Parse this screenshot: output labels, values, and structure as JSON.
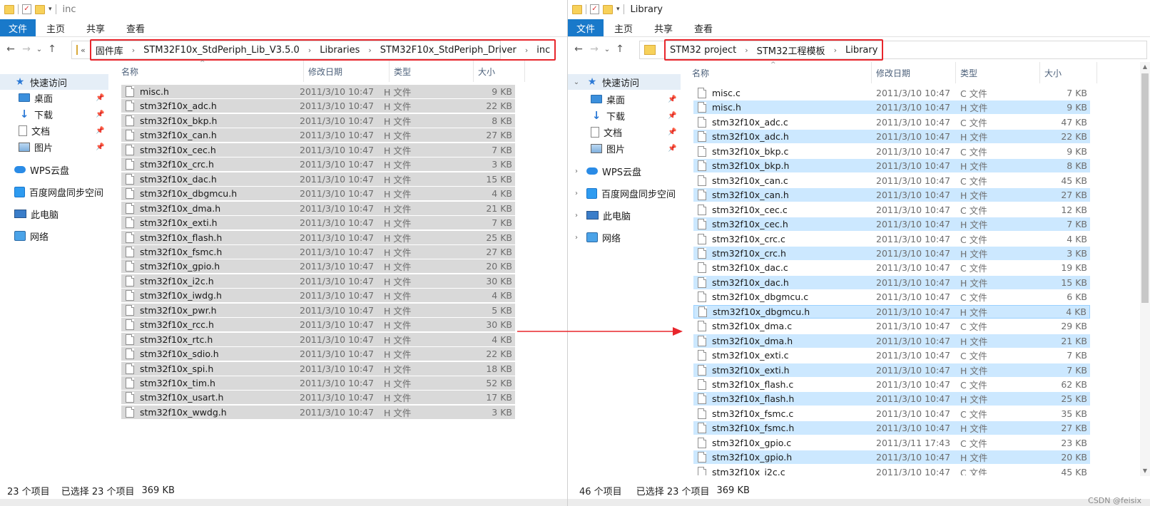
{
  "left": {
    "title": "inc",
    "ribbon": [
      "文件",
      "主页",
      "共享",
      "查看"
    ],
    "addr_prefix": "«",
    "breadcrumbs": [
      "固件库",
      "STM32F10x_StdPeriph_Lib_V3.5.0",
      "Libraries",
      "STM32F10x_StdPeriph_Driver",
      "inc"
    ],
    "columns": [
      "名称",
      "修改日期",
      "类型",
      "大小"
    ],
    "nav": [
      {
        "label": "快速访问",
        "icon": "star-icon",
        "selected": true
      },
      {
        "label": "桌面",
        "icon": "desktop-icon",
        "pinned": true
      },
      {
        "label": "下载",
        "icon": "download-icon",
        "pinned": true
      },
      {
        "label": "文档",
        "icon": "document-icon",
        "pinned": true
      },
      {
        "label": "图片",
        "icon": "pictures-icon",
        "pinned": true
      },
      {
        "label": "WPS云盘",
        "icon": "cloud-icon"
      },
      {
        "label": "百度网盘同步空间",
        "icon": "baidu-netdisk-icon"
      },
      {
        "label": "此电脑",
        "icon": "computer-icon"
      },
      {
        "label": "网络",
        "icon": "network-icon"
      }
    ],
    "files": [
      {
        "name": "misc.h",
        "date": "2011/3/10 10:47",
        "type": "H 文件",
        "size": "9 KB"
      },
      {
        "name": "stm32f10x_adc.h",
        "date": "2011/3/10 10:47",
        "type": "H 文件",
        "size": "22 KB"
      },
      {
        "name": "stm32f10x_bkp.h",
        "date": "2011/3/10 10:47",
        "type": "H 文件",
        "size": "8 KB"
      },
      {
        "name": "stm32f10x_can.h",
        "date": "2011/3/10 10:47",
        "type": "H 文件",
        "size": "27 KB"
      },
      {
        "name": "stm32f10x_cec.h",
        "date": "2011/3/10 10:47",
        "type": "H 文件",
        "size": "7 KB"
      },
      {
        "name": "stm32f10x_crc.h",
        "date": "2011/3/10 10:47",
        "type": "H 文件",
        "size": "3 KB"
      },
      {
        "name": "stm32f10x_dac.h",
        "date": "2011/3/10 10:47",
        "type": "H 文件",
        "size": "15 KB"
      },
      {
        "name": "stm32f10x_dbgmcu.h",
        "date": "2011/3/10 10:47",
        "type": "H 文件",
        "size": "4 KB"
      },
      {
        "name": "stm32f10x_dma.h",
        "date": "2011/3/10 10:47",
        "type": "H 文件",
        "size": "21 KB"
      },
      {
        "name": "stm32f10x_exti.h",
        "date": "2011/3/10 10:47",
        "type": "H 文件",
        "size": "7 KB"
      },
      {
        "name": "stm32f10x_flash.h",
        "date": "2011/3/10 10:47",
        "type": "H 文件",
        "size": "25 KB"
      },
      {
        "name": "stm32f10x_fsmc.h",
        "date": "2011/3/10 10:47",
        "type": "H 文件",
        "size": "27 KB"
      },
      {
        "name": "stm32f10x_gpio.h",
        "date": "2011/3/10 10:47",
        "type": "H 文件",
        "size": "20 KB"
      },
      {
        "name": "stm32f10x_i2c.h",
        "date": "2011/3/10 10:47",
        "type": "H 文件",
        "size": "30 KB"
      },
      {
        "name": "stm32f10x_iwdg.h",
        "date": "2011/3/10 10:47",
        "type": "H 文件",
        "size": "4 KB"
      },
      {
        "name": "stm32f10x_pwr.h",
        "date": "2011/3/10 10:47",
        "type": "H 文件",
        "size": "5 KB"
      },
      {
        "name": "stm32f10x_rcc.h",
        "date": "2011/3/10 10:47",
        "type": "H 文件",
        "size": "30 KB"
      },
      {
        "name": "stm32f10x_rtc.h",
        "date": "2011/3/10 10:47",
        "type": "H 文件",
        "size": "4 KB"
      },
      {
        "name": "stm32f10x_sdio.h",
        "date": "2011/3/10 10:47",
        "type": "H 文件",
        "size": "22 KB"
      },
      {
        "name": "stm32f10x_spi.h",
        "date": "2011/3/10 10:47",
        "type": "H 文件",
        "size": "18 KB"
      },
      {
        "name": "stm32f10x_tim.h",
        "date": "2011/3/10 10:47",
        "type": "H 文件",
        "size": "52 KB"
      },
      {
        "name": "stm32f10x_usart.h",
        "date": "2011/3/10 10:47",
        "type": "H 文件",
        "size": "17 KB"
      },
      {
        "name": "stm32f10x_wwdg.h",
        "date": "2011/3/10 10:47",
        "type": "H 文件",
        "size": "3 KB"
      }
    ],
    "status": {
      "count": "23 个项目",
      "selected": "已选择 23 个项目",
      "size": "369 KB"
    }
  },
  "right": {
    "title": "Library",
    "ribbon": [
      "文件",
      "主页",
      "共享",
      "查看"
    ],
    "breadcrumbs": [
      "STM32 project",
      "STM32工程模板",
      "Library"
    ],
    "columns": [
      "名称",
      "修改日期",
      "类型",
      "大小"
    ],
    "nav": [
      {
        "label": "快速访问",
        "icon": "star-icon",
        "selected": true,
        "expander": "⌄"
      },
      {
        "label": "桌面",
        "icon": "desktop-icon",
        "pinned": true
      },
      {
        "label": "下载",
        "icon": "download-icon",
        "pinned": true
      },
      {
        "label": "文档",
        "icon": "document-icon",
        "pinned": true
      },
      {
        "label": "图片",
        "icon": "pictures-icon",
        "pinned": true
      },
      {
        "label": "WPS云盘",
        "icon": "cloud-icon",
        "expander": "›"
      },
      {
        "label": "百度网盘同步空间",
        "icon": "baidu-netdisk-icon",
        "expander": "›"
      },
      {
        "label": "此电脑",
        "icon": "computer-icon",
        "expander": "›"
      },
      {
        "label": "网络",
        "icon": "network-icon",
        "expander": "›"
      }
    ],
    "files": [
      {
        "name": "misc.c",
        "date": "2011/3/10 10:47",
        "type": "C 文件",
        "size": "7 KB",
        "selected": false
      },
      {
        "name": "misc.h",
        "date": "2011/3/10 10:47",
        "type": "H 文件",
        "size": "9 KB",
        "selected": true
      },
      {
        "name": "stm32f10x_adc.c",
        "date": "2011/3/10 10:47",
        "type": "C 文件",
        "size": "47 KB",
        "selected": false
      },
      {
        "name": "stm32f10x_adc.h",
        "date": "2011/3/10 10:47",
        "type": "H 文件",
        "size": "22 KB",
        "selected": true
      },
      {
        "name": "stm32f10x_bkp.c",
        "date": "2011/3/10 10:47",
        "type": "C 文件",
        "size": "9 KB",
        "selected": false
      },
      {
        "name": "stm32f10x_bkp.h",
        "date": "2011/3/10 10:47",
        "type": "H 文件",
        "size": "8 KB",
        "selected": true
      },
      {
        "name": "stm32f10x_can.c",
        "date": "2011/3/10 10:47",
        "type": "C 文件",
        "size": "45 KB",
        "selected": false
      },
      {
        "name": "stm32f10x_can.h",
        "date": "2011/3/10 10:47",
        "type": "H 文件",
        "size": "27 KB",
        "selected": true
      },
      {
        "name": "stm32f10x_cec.c",
        "date": "2011/3/10 10:47",
        "type": "C 文件",
        "size": "12 KB",
        "selected": false
      },
      {
        "name": "stm32f10x_cec.h",
        "date": "2011/3/10 10:47",
        "type": "H 文件",
        "size": "7 KB",
        "selected": true
      },
      {
        "name": "stm32f10x_crc.c",
        "date": "2011/3/10 10:47",
        "type": "C 文件",
        "size": "4 KB",
        "selected": false
      },
      {
        "name": "stm32f10x_crc.h",
        "date": "2011/3/10 10:47",
        "type": "H 文件",
        "size": "3 KB",
        "selected": true
      },
      {
        "name": "stm32f10x_dac.c",
        "date": "2011/3/10 10:47",
        "type": "C 文件",
        "size": "19 KB",
        "selected": false
      },
      {
        "name": "stm32f10x_dac.h",
        "date": "2011/3/10 10:47",
        "type": "H 文件",
        "size": "15 KB",
        "selected": true
      },
      {
        "name": "stm32f10x_dbgmcu.c",
        "date": "2011/3/10 10:47",
        "type": "C 文件",
        "size": "6 KB",
        "selected": false
      },
      {
        "name": "stm32f10x_dbgmcu.h",
        "date": "2011/3/10 10:47",
        "type": "H 文件",
        "size": "4 KB",
        "selected": true,
        "focused": true
      },
      {
        "name": "stm32f10x_dma.c",
        "date": "2011/3/10 10:47",
        "type": "C 文件",
        "size": "29 KB",
        "selected": false
      },
      {
        "name": "stm32f10x_dma.h",
        "date": "2011/3/10 10:47",
        "type": "H 文件",
        "size": "21 KB",
        "selected": true
      },
      {
        "name": "stm32f10x_exti.c",
        "date": "2011/3/10 10:47",
        "type": "C 文件",
        "size": "7 KB",
        "selected": false
      },
      {
        "name": "stm32f10x_exti.h",
        "date": "2011/3/10 10:47",
        "type": "H 文件",
        "size": "7 KB",
        "selected": true
      },
      {
        "name": "stm32f10x_flash.c",
        "date": "2011/3/10 10:47",
        "type": "C 文件",
        "size": "62 KB",
        "selected": false
      },
      {
        "name": "stm32f10x_flash.h",
        "date": "2011/3/10 10:47",
        "type": "H 文件",
        "size": "25 KB",
        "selected": true
      },
      {
        "name": "stm32f10x_fsmc.c",
        "date": "2011/3/10 10:47",
        "type": "C 文件",
        "size": "35 KB",
        "selected": false
      },
      {
        "name": "stm32f10x_fsmc.h",
        "date": "2011/3/10 10:47",
        "type": "H 文件",
        "size": "27 KB",
        "selected": true
      },
      {
        "name": "stm32f10x_gpio.c",
        "date": "2011/3/11 17:43",
        "type": "C 文件",
        "size": "23 KB",
        "selected": false
      },
      {
        "name": "stm32f10x_gpio.h",
        "date": "2011/3/10 10:47",
        "type": "H 文件",
        "size": "20 KB",
        "selected": true
      },
      {
        "name": "stm32f10x_i2c.c",
        "date": "2011/3/10 10:47",
        "type": "C 文件",
        "size": "45 KB",
        "selected": false
      }
    ],
    "status": {
      "count": "46 个项目",
      "selected": "已选择 23 个项目",
      "size": "369 KB"
    }
  },
  "watermark": "CSDN @feisix",
  "colors": {
    "ribbon_file": "#1979ca",
    "highlight_box": "#e8262c",
    "arrow": "#e8262c",
    "selection_blue": "#cce8ff",
    "selection_gray": "#d9d9d9"
  }
}
